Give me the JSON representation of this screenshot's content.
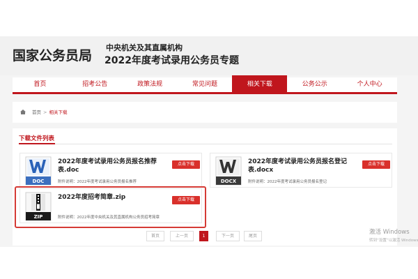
{
  "header": {
    "brand": "国家公务员局",
    "subtitle_line1": "中央机关及其直属机构",
    "subtitle_line2": "2022年度考试录用公务员专题"
  },
  "nav": {
    "items": [
      {
        "label": "首页",
        "active": false
      },
      {
        "label": "招考公告",
        "active": false
      },
      {
        "label": "政策法规",
        "active": false
      },
      {
        "label": "常见问题",
        "active": false
      },
      {
        "label": "相关下载",
        "active": true
      },
      {
        "label": "公务公示",
        "active": false
      },
      {
        "label": "个人中心",
        "active": false
      }
    ]
  },
  "breadcrumb": {
    "home": "首页",
    "separator": ">",
    "current": "相关下载"
  },
  "section": {
    "title": "下载文件列表"
  },
  "files": [
    {
      "title": "2022年度考试录用公务员报名推荐表.doc",
      "icon_label": "DOC",
      "icon": "word-doc-icon",
      "desc": "附件说明：2022年度考试录用公务员报名推荐",
      "button": "点击下载"
    },
    {
      "title": "2022年度考试录用公务员报名登记表.docx",
      "icon_label": "DOCX",
      "icon": "word-docx-icon",
      "desc": "附件说明：2022年度考试录用公务员报名登记",
      "button": "点击下载"
    },
    {
      "title": "2022年度招考简章.zip",
      "icon_label": "ZIP",
      "icon": "zip-archive-icon",
      "desc": "附件说明：2022年度中央机关及其直属机构公务员招考简章",
      "button": "点击下载"
    }
  ],
  "pagination": {
    "first": "首页",
    "prev": "上一页",
    "current": "1",
    "next": "下一页",
    "last": "尾页"
  },
  "watermark": {
    "line1": "激活 Windows",
    "line2": "转到“设置”以激活 Windows。"
  },
  "colors": {
    "accent": "#c0161d",
    "button": "#d9302b",
    "highlight": "#d53a35"
  }
}
